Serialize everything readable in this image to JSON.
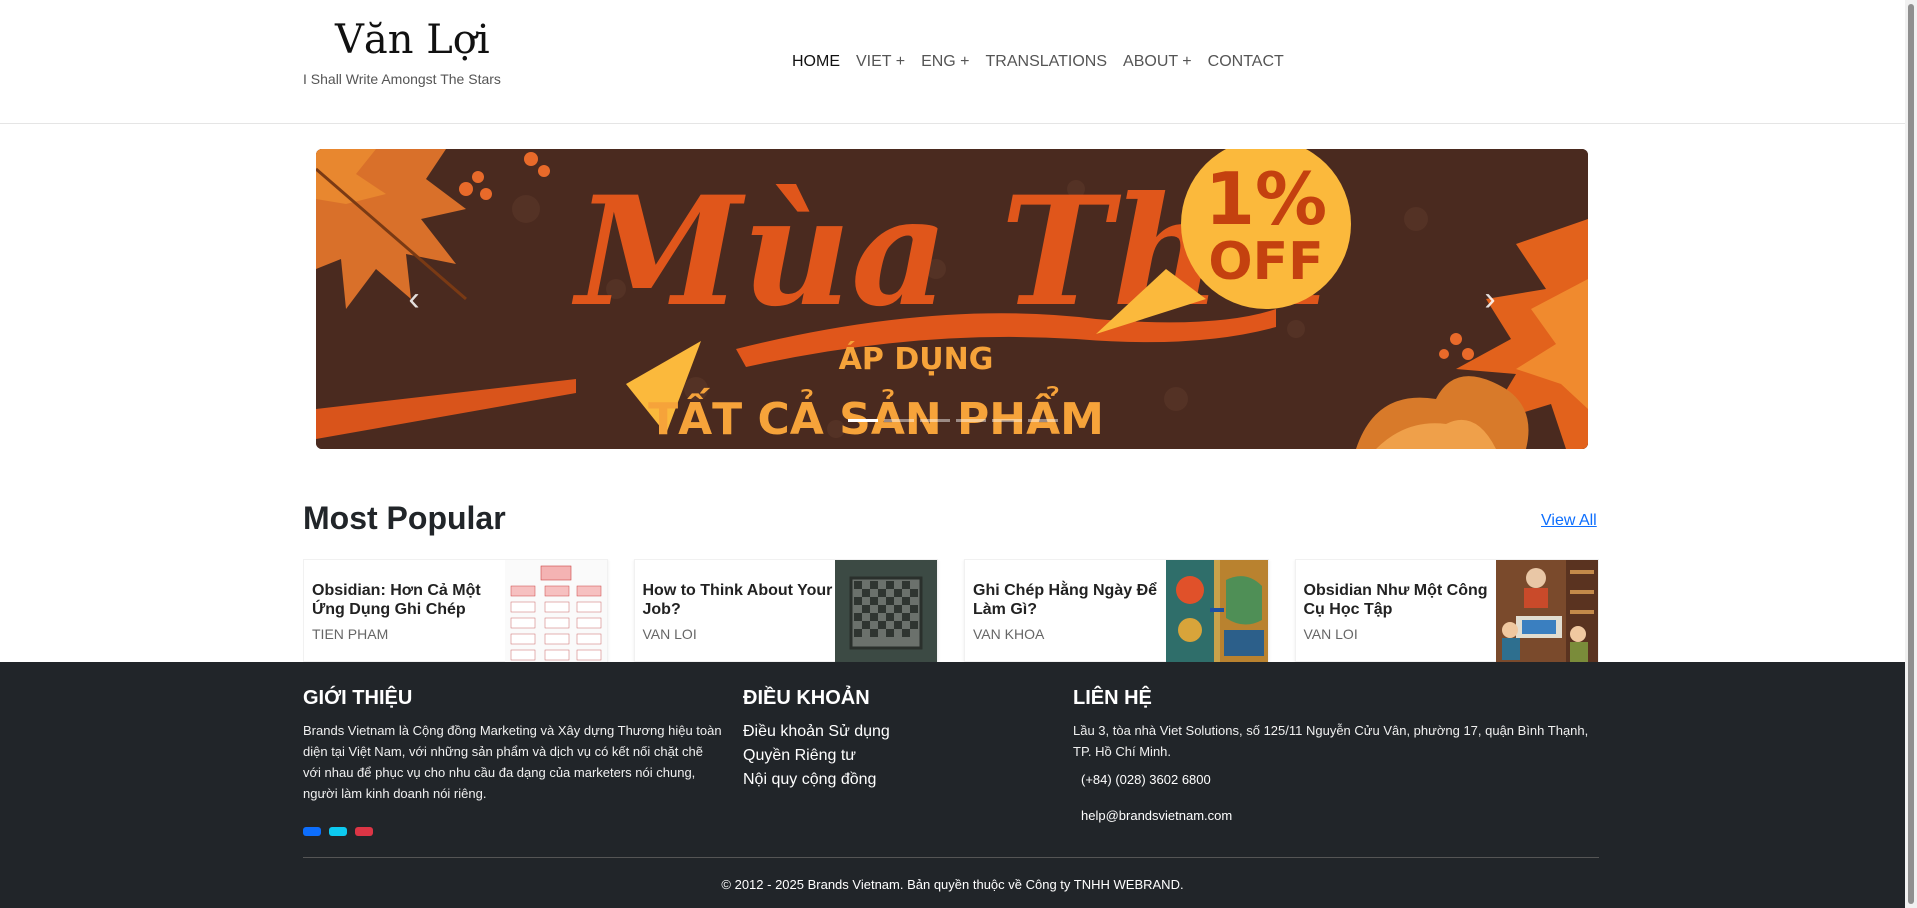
{
  "header": {
    "brand_title": "Văn Lợi",
    "brand_tagline": "I Shall Write Amongst The Stars",
    "nav": [
      {
        "label": "HOME"
      },
      {
        "label": "VIET +"
      },
      {
        "label": "ENG +"
      },
      {
        "label": "TRANSLATIONS"
      },
      {
        "label": "ABOUT +"
      },
      {
        "label": "CONTACT"
      }
    ]
  },
  "banner": {
    "headline": "Mùa Thu",
    "badge_percent": "1%",
    "badge_off": "OFF",
    "line1": "ÁP DỤNG",
    "line2": "TẤT CẢ SẢN PHẨM",
    "slide_count": 6,
    "active_slide": 1,
    "colors": {
      "background": "#4a2a1f",
      "accent": "#e0561b",
      "badge": "#fbb93c"
    }
  },
  "popular": {
    "title": "Most Popular",
    "view_all": "View All",
    "cards": [
      {
        "title": "Obsidian: Hơn Cả Một Ứng Dụng Ghi Chép",
        "author": "TIEN PHAM"
      },
      {
        "title": "How to Think About Your Job?",
        "author": "VAN LOI"
      },
      {
        "title": "Ghi Chép Hằng Ngày Để Làm Gì?",
        "author": "VAN KHOA"
      },
      {
        "title": "Obsidian Như Một Công Cụ Học Tập",
        "author": "VAN LOI"
      }
    ]
  },
  "footer": {
    "about_heading": "GIỚI THIỆU",
    "about_text": "Brands Vietnam là Cộng đồng Marketing và Xây dựng Thương hiệu toàn diện tại Việt Nam, với những sản phẩm và dịch vụ có kết nối chặt chẽ với nhau để phục vụ cho nhu cầu đa dạng của marketers nói chung, người làm kinh doanh nói riêng.",
    "terms_heading": "ĐIỀU KHOẢN",
    "terms_links": [
      "Điều khoản Sử dụng",
      "Quyền Riêng tư",
      "Nội quy cộng đồng"
    ],
    "contact_heading": "LIÊN HỆ",
    "contact_address": "Lầu 3, tòa nhà Viet Solutions, số 125/11 Nguyễn Cửu Vân, phường 17, quận Bình Thạnh, TP. Hồ Chí Minh.",
    "contact_phone": "(+84) (028) 3602 6800",
    "contact_email": "help@brandsvietnam.com",
    "social_colors": [
      "#0d6efd",
      "#0dcaf0",
      "#dc3545"
    ],
    "copyright": "© 2012 - 2025 Brands Vietnam. Bản quyền thuộc về Công ty TNHH WEBRAND."
  }
}
